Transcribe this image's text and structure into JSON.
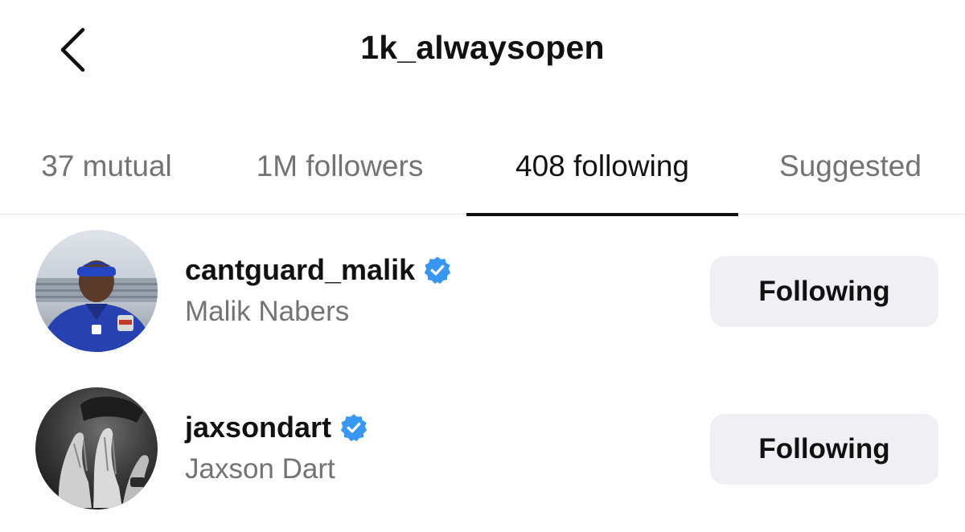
{
  "header": {
    "title": "1k_alwaysopen",
    "back_icon": "chevron-left-icon"
  },
  "tabs": [
    {
      "label": "37 mutual",
      "active": false
    },
    {
      "label": "1M followers",
      "active": false
    },
    {
      "label": "408 following",
      "active": true
    },
    {
      "label": "Suggested",
      "active": false
    }
  ],
  "accounts": [
    {
      "username": "cantguard_malik",
      "full_name": "Malik Nabers",
      "verified": true,
      "button_label": "Following",
      "avatar_icon": "profile-photo-avatar"
    },
    {
      "username": "jaxsondart",
      "full_name": "Jaxson Dart",
      "verified": true,
      "button_label": "Following",
      "avatar_icon": "profile-photo-avatar"
    }
  ],
  "colors": {
    "text_primary": "#111111",
    "text_secondary": "#737373",
    "verified_blue": "#3897f0",
    "button_bg": "#efeff4",
    "active_tab_indicator": "#111111",
    "divider": "#e6e6e6"
  }
}
